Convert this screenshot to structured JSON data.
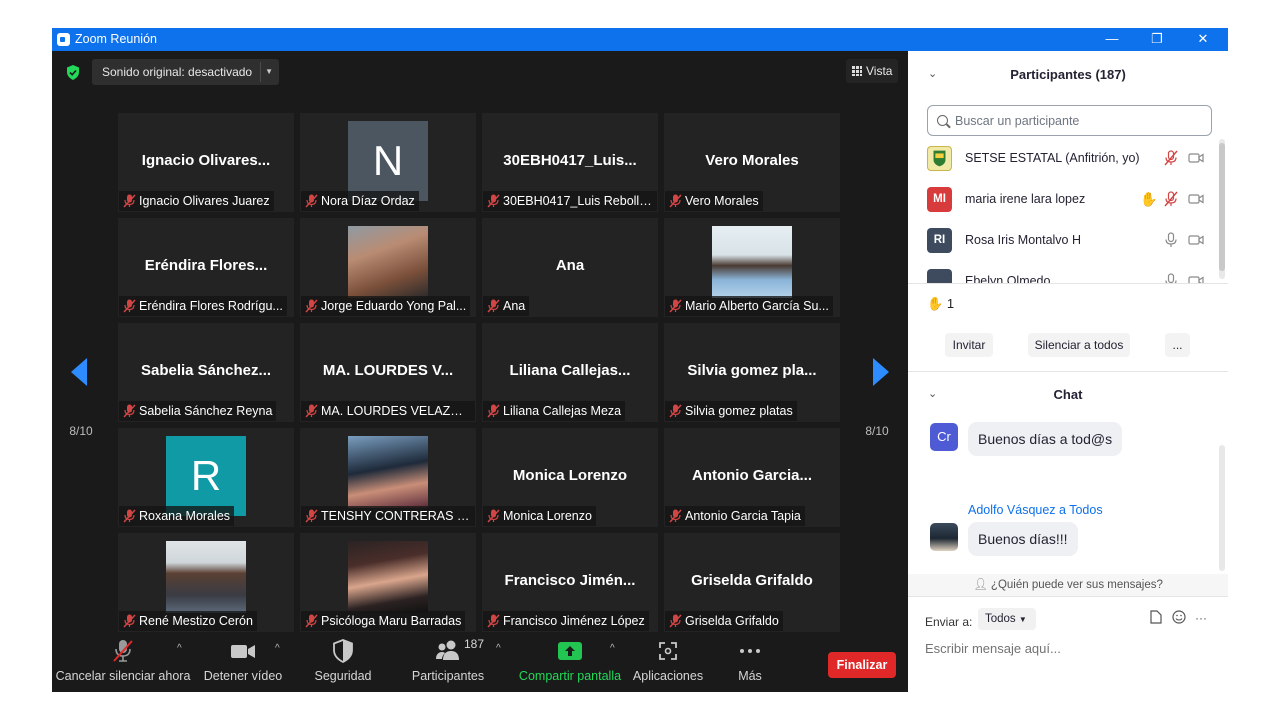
{
  "window": {
    "title": "Zoom Reunión",
    "controls": [
      "—",
      "❐",
      "✕"
    ]
  },
  "meeting": {
    "sound_button": "Sonido original: desactivado",
    "view_button": "Vista",
    "page_indicator": "8/10",
    "tiles": [
      {
        "big": "Ignacio  Olivares...",
        "label": "Ignacio Olivares Juarez"
      },
      {
        "avatar_letter": "N",
        "avatar_color": "#4b5661",
        "label": "Nora Díaz Ordaz"
      },
      {
        "big": "30EBH0417_Luis...",
        "label": "30EBH0417_Luis Rebolle..."
      },
      {
        "big": "Vero Morales",
        "label": "Vero Morales"
      },
      {
        "big": "Eréndira  Flores...",
        "label": "Eréndira Flores Rodrígu..."
      },
      {
        "photo": "man-selfie",
        "label": "Jorge Eduardo Yong Pal..."
      },
      {
        "big": "Ana",
        "label": "Ana"
      },
      {
        "photo": "man-outdoor",
        "label": "Mario Alberto García Su..."
      },
      {
        "big": "Sabelia  Sánchez...",
        "label": "Sabelia Sánchez Reyna"
      },
      {
        "big": "MA. LOURDES  V...",
        "label": "MA. LOURDES VELAZQU..."
      },
      {
        "big": "Liliana  Callejas...",
        "label": "Liliana Callejas Meza"
      },
      {
        "big": "Silvia  gomez  pla...",
        "label": "Silvia gomez platas"
      },
      {
        "avatar_letter": "R",
        "avatar_color": "#0f9aa5",
        "label": "Roxana Morales"
      },
      {
        "photo": "woman-portrait",
        "label": "TENSHY CONTRERAS B..."
      },
      {
        "big": "Monica Lorenzo",
        "label": "Monica Lorenzo"
      },
      {
        "big": "Antonio  Garcia...",
        "label": "Antonio Garcia Tapia"
      },
      {
        "photo": "man-office",
        "label": "René Mestizo Cerón"
      },
      {
        "photo": "woman-red-lips",
        "label": "Psicóloga Maru Barradas"
      },
      {
        "big": "Francisco  Jimén...",
        "label": "Francisco Jiménez López"
      },
      {
        "big": "Griselda Grifaldo",
        "label": "Griselda Grifaldo"
      }
    ]
  },
  "toolbar": {
    "mute": "Cancelar silenciar ahora",
    "video": "Detener vídeo",
    "security": "Seguridad",
    "participants": "Participantes",
    "participants_count": "187",
    "share": "Compartir pantalla",
    "apps": "Aplicaciones",
    "more": "Más",
    "end": "Finalizar"
  },
  "participants_panel": {
    "title": "Participantes (187)",
    "search_placeholder": "Buscar un participante",
    "list": [
      {
        "initials": "",
        "name": "SETSE ESTATAL (Anfitrión, yo)",
        "color": "#f1e9a6"
      },
      {
        "initials": "MI",
        "name": "maria irene lara lopez",
        "color": "#d83b3b"
      },
      {
        "initials": "RI",
        "name": "Rosa Iris Montalvo H",
        "color": "#3e4b5e"
      },
      {
        "initials": "",
        "name": "Ebelyn Olmedo",
        "color": "#3e4b5e"
      }
    ],
    "raised_hands": "1",
    "invite": "Invitar",
    "mute_all": "Silenciar a todos",
    "more": "..."
  },
  "chat_panel": {
    "title": "Chat",
    "messages": [
      {
        "avatar": "Cr",
        "text": "Buenos días a tod@s"
      },
      {
        "sender": "Adolfo Vásquez a Todos",
        "text": "Buenos días!!!"
      }
    ],
    "who_can_see": "¿Quién puede ver sus mensajes?",
    "send_to_label": "Enviar a:",
    "send_to_value": "Todos",
    "input_placeholder": "Escribir mensaje aquí..."
  }
}
